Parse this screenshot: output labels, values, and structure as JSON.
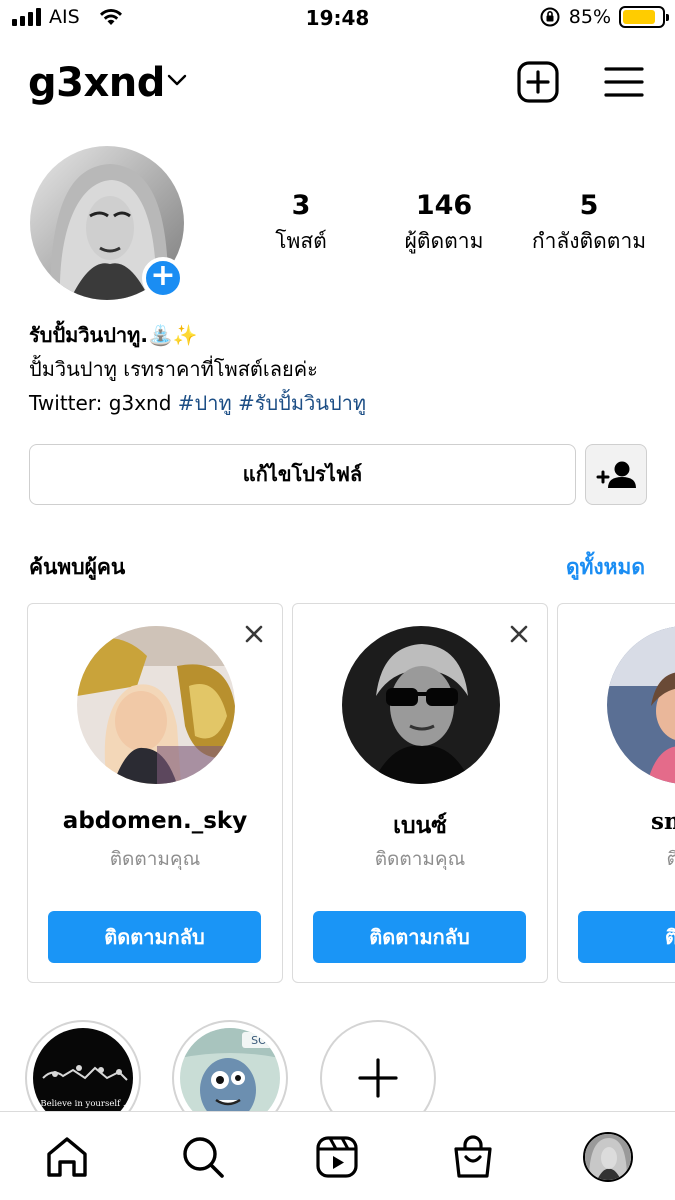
{
  "status_bar": {
    "carrier": "AIS",
    "time": "19:48",
    "battery_percent": "85%",
    "battery_level": 0.85,
    "battery_color": "#ffcc00"
  },
  "header": {
    "username": "g3xnd",
    "icons": [
      "chevron-down-icon",
      "add-square-icon",
      "menu-icon"
    ]
  },
  "profile": {
    "stats": [
      {
        "value": "3",
        "label": "โพสต์"
      },
      {
        "value": "146",
        "label": "ผู้ติดตาม"
      },
      {
        "value": "5",
        "label": "กำลังติดตาม"
      }
    ],
    "bio": {
      "name": "รับปั้มวินปาทู.",
      "name_emoji": "⛲✨",
      "line1": "ปั้มวินปาทู เรทราคาที่โพสต์เลยค่ะ",
      "line2_prefix": "Twitter: g3xnd ",
      "hashtags": "#ปาทู #รับปั้มวินปาทู",
      "hashtag_color": "#1c4e85"
    },
    "edit_profile_label": "แก้ไขโปรไฟล์"
  },
  "discover": {
    "title": "ค้นพบผู้คน",
    "see_all": "ดูทั้งหมด",
    "accent": "#1a8df3",
    "cards": [
      {
        "name": "abdomen._sky",
        "subtitle": "ติดตามคุณ",
        "button": "ติดตามกลับ"
      },
      {
        "name": "เบนซ์",
        "subtitle": "ติดตามคุณ",
        "button": "ติดตามกลับ"
      },
      {
        "name": "smoo",
        "subtitle": "ติดต",
        "button": "ติดต"
      }
    ]
  },
  "highlights": [
    {
      "caption": "Believe in yourself ."
    },
    {
      "caption": "SO"
    },
    {
      "caption": ""
    }
  ],
  "tab_bar": {
    "icons": [
      "home-icon",
      "search-icon",
      "reels-icon",
      "shop-icon",
      "profile-avatar"
    ]
  }
}
